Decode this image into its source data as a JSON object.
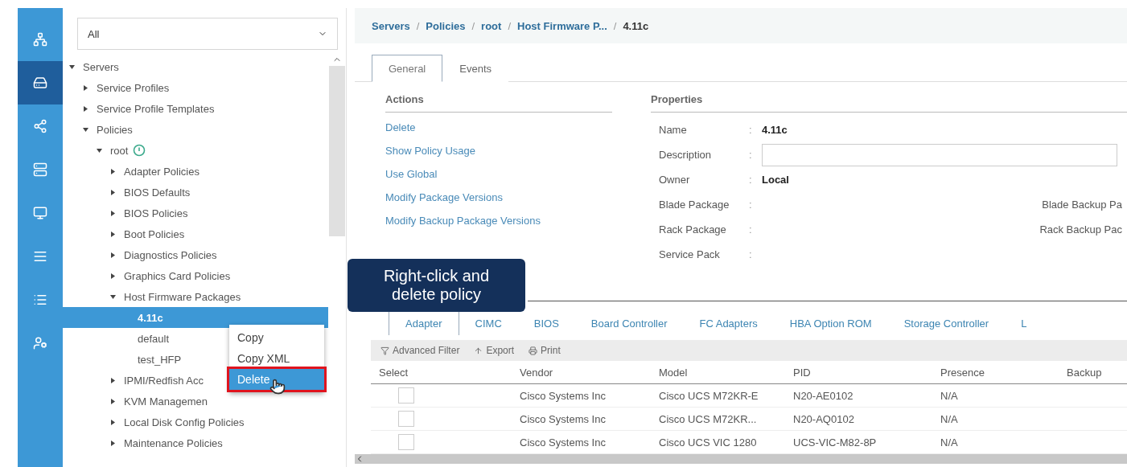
{
  "rail": [
    {
      "selected": false
    },
    {
      "selected": true
    },
    {
      "selected": false
    },
    {
      "selected": false
    },
    {
      "selected": false
    },
    {
      "selected": false
    },
    {
      "selected": false
    },
    {
      "selected": false
    }
  ],
  "filter": {
    "value": "All"
  },
  "tree": [
    {
      "label": "Servers",
      "expanded": true,
      "selected": false,
      "children": [
        {
          "label": "Service Profiles",
          "expanded": false,
          "selected": false
        },
        {
          "label": "Service Profile Templates",
          "expanded": false,
          "selected": false
        },
        {
          "label": "Policies",
          "expanded": true,
          "selected": false,
          "children": [
            {
              "label": "root",
              "expanded": true,
              "selected": false,
              "badge": true,
              "children": [
                {
                  "label": "Adapter Policies",
                  "expanded": false,
                  "selected": false
                },
                {
                  "label": "BIOS Defaults",
                  "expanded": false,
                  "selected": false
                },
                {
                  "label": "BIOS Policies",
                  "expanded": false,
                  "selected": false
                },
                {
                  "label": "Boot Policies",
                  "expanded": false,
                  "selected": false
                },
                {
                  "label": "Diagnostics Policies",
                  "expanded": false,
                  "selected": false
                },
                {
                  "label": "Graphics Card Policies",
                  "expanded": false,
                  "selected": false
                },
                {
                  "label": "Host Firmware Packages",
                  "expanded": true,
                  "selected": false,
                  "children": [
                    {
                      "label": "4.11c",
                      "selected": true
                    },
                    {
                      "label": "default",
                      "selected": false
                    },
                    {
                      "label": "test_HFP",
                      "selected": false
                    }
                  ]
                },
                {
                  "label": "IPMI/Redfish Acc",
                  "expanded": false,
                  "selected": false
                },
                {
                  "label": "KVM Managemen",
                  "expanded": false,
                  "selected": false
                },
                {
                  "label": "Local Disk Config Policies",
                  "expanded": false,
                  "selected": false
                },
                {
                  "label": "Maintenance Policies",
                  "expanded": false,
                  "selected": false
                }
              ]
            }
          ]
        }
      ]
    }
  ],
  "context_menu": {
    "items": [
      {
        "label": "Copy",
        "selected": false,
        "outlined": false
      },
      {
        "label": "Copy XML",
        "selected": false,
        "outlined": false
      },
      {
        "label": "Delete",
        "selected": true,
        "outlined": true
      }
    ]
  },
  "tooltip": "Right-click and delete policy",
  "breadcrumb": {
    "separator": "/",
    "items": [
      "Servers",
      "Policies",
      "root",
      "Host Firmware P...",
      "4.11c"
    ]
  },
  "tabs": [
    {
      "label": "General",
      "selected": true
    },
    {
      "label": "Events",
      "selected": false
    }
  ],
  "actions": {
    "title": "Actions",
    "items": [
      "Delete",
      "Show Policy Usage",
      "Use Global",
      "Modify Package Versions",
      "Modify Backup Package Versions"
    ]
  },
  "properties": {
    "title": "Properties",
    "rows": [
      {
        "kind": "value",
        "label": "Name",
        "separator": ":",
        "value": "4.11c"
      },
      {
        "kind": "input",
        "label": "Description",
        "separator": ":"
      },
      {
        "kind": "value",
        "label": "Owner",
        "separator": ":",
        "value": "Local"
      },
      {
        "kind": "pair",
        "label": "Blade Package",
        "separator": ":",
        "right": "Blade Backup Pa"
      },
      {
        "kind": "pair",
        "label": "Rack Package",
        "separator": ":",
        "right": "Rack Backup Pac"
      },
      {
        "kind": "pair",
        "label": "Service Pack",
        "separator": ":"
      }
    ]
  },
  "component_tabs": [
    {
      "label": "Adapter",
      "selected": true
    },
    {
      "label": "CIMC",
      "selected": false
    },
    {
      "label": "BIOS",
      "selected": false
    },
    {
      "label": "Board Controller",
      "selected": false
    },
    {
      "label": "FC Adapters",
      "selected": false
    },
    {
      "label": "HBA Option ROM",
      "selected": false
    },
    {
      "label": "Storage Controller",
      "selected": false
    },
    {
      "label": "L",
      "selected": false
    }
  ],
  "toolbar": [
    {
      "kind": "filter",
      "label": "Advanced Filter"
    },
    {
      "kind": "export",
      "label": "Export"
    },
    {
      "kind": "print",
      "label": "Print"
    }
  ],
  "table": {
    "columns": [
      "Select",
      "Vendor",
      "Model",
      "PID",
      "Presence",
      "Backup"
    ],
    "rows": [
      {
        "checked": false,
        "cells": [
          "",
          "Cisco Systems Inc",
          "Cisco UCS M72KR-E",
          "N20-AE0102",
          "N/A"
        ]
      },
      {
        "checked": false,
        "cells": [
          "",
          "Cisco Systems Inc",
          "Cisco UCS M72KR...",
          "N20-AQ0102",
          "N/A"
        ]
      },
      {
        "checked": false,
        "cells": [
          "",
          "Cisco Systems Inc",
          "Cisco UCS VIC 1280",
          "UCS-VIC-M82-8P",
          "N/A"
        ]
      }
    ]
  }
}
